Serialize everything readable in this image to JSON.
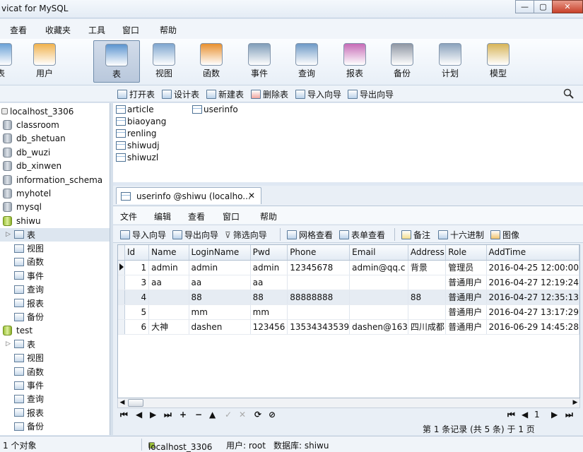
{
  "window": {
    "title": "vicat for MySQL",
    "buttons": [
      "—",
      "▢",
      "✕"
    ]
  },
  "menu": [
    "查看",
    "收藏夹",
    "工具",
    "窗口",
    "帮助"
  ],
  "toolbar": [
    {
      "label": "表",
      "icon": "table-icon",
      "color": "#6aa1d6"
    },
    {
      "label": "用户",
      "icon": "user-icon",
      "color": "#f0b24d"
    },
    {
      "label": "表",
      "icon": "table-icon",
      "color": "#5b94cf",
      "active": true
    },
    {
      "label": "视图",
      "icon": "view-icon",
      "color": "#7ea6cf"
    },
    {
      "label": "函数",
      "icon": "function-icon",
      "color": "#e8902f"
    },
    {
      "label": "事件",
      "icon": "event-icon",
      "color": "#7f9db9"
    },
    {
      "label": "查询",
      "icon": "query-icon",
      "color": "#6d99c6"
    },
    {
      "label": "报表",
      "icon": "report-icon",
      "color": "#c66bb7"
    },
    {
      "label": "备份",
      "icon": "backup-icon",
      "color": "#8e96a3"
    },
    {
      "label": "计划",
      "icon": "schedule-icon",
      "color": "#8aa2bc"
    },
    {
      "label": "模型",
      "icon": "model-icon",
      "color": "#d7b457"
    }
  ],
  "subtoolbar": [
    "打开表",
    "设计表",
    "新建表",
    "删除表",
    "导入向导",
    "导出向导"
  ],
  "tree": [
    {
      "label": "localhost_3306",
      "level": 0,
      "type": "connection"
    },
    {
      "label": "classroom",
      "level": 1,
      "type": "db"
    },
    {
      "label": "db_shetuan",
      "level": 1,
      "type": "db"
    },
    {
      "label": "db_wuzi",
      "level": 1,
      "type": "db"
    },
    {
      "label": "db_xinwen",
      "level": 1,
      "type": "db"
    },
    {
      "label": "information_schema",
      "level": 1,
      "type": "db"
    },
    {
      "label": "myhotel",
      "level": 1,
      "type": "db"
    },
    {
      "label": "mysql",
      "level": 1,
      "type": "db"
    },
    {
      "label": "shiwu",
      "level": 1,
      "type": "db-open"
    },
    {
      "label": "表",
      "level": 2,
      "type": "item",
      "selected": true
    },
    {
      "label": "视图",
      "level": 2,
      "type": "item"
    },
    {
      "label": "函数",
      "level": 2,
      "type": "item"
    },
    {
      "label": "事件",
      "level": 2,
      "type": "item"
    },
    {
      "label": "查询",
      "level": 2,
      "type": "item"
    },
    {
      "label": "报表",
      "level": 2,
      "type": "item"
    },
    {
      "label": "备份",
      "level": 2,
      "type": "item"
    },
    {
      "label": "test",
      "level": 1,
      "type": "db-open"
    },
    {
      "label": "表",
      "level": 2,
      "type": "item"
    },
    {
      "label": "视图",
      "level": 2,
      "type": "item"
    },
    {
      "label": "函数",
      "level": 2,
      "type": "item"
    },
    {
      "label": "事件",
      "level": 2,
      "type": "item"
    },
    {
      "label": "查询",
      "level": 2,
      "type": "item"
    },
    {
      "label": "报表",
      "level": 2,
      "type": "item"
    },
    {
      "label": "备份",
      "level": 2,
      "type": "item"
    }
  ],
  "objects": [
    "article",
    "biaoyang",
    "renling",
    "shiwudj",
    "shiwuzl",
    "userinfo"
  ],
  "doc": {
    "tab_title": "userinfo @shiwu (localho...",
    "menu": [
      "文件",
      "编辑",
      "查看",
      "窗口",
      "帮助"
    ],
    "toolbar": [
      "导入向导",
      "导出向导",
      "筛选向导",
      "网格查看",
      "表单查看",
      "备注",
      "十六进制",
      "图像"
    ],
    "columns": [
      "Id",
      "Name",
      "LoginName",
      "Pwd",
      "Phone",
      "Email",
      "Address",
      "Role",
      "AddTime"
    ],
    "rows": [
      [
        "1",
        "admin",
        "admin",
        "admin",
        "12345678",
        "admin@qq.c",
        "背景",
        "管理员",
        "2016-04-25 12:00:00"
      ],
      [
        "3",
        "aa",
        "aa",
        "aa",
        "",
        "",
        "",
        "普通用户",
        "2016-04-27 12:19:24"
      ],
      [
        "4",
        "",
        "88",
        "88",
        "88888888",
        "",
        "88",
        "普通用户",
        "2016-04-27 12:35:13"
      ],
      [
        "5",
        "",
        "mm",
        "mm",
        "",
        "",
        "",
        "普通用户",
        "2016-04-27 13:17:29"
      ],
      [
        "6",
        "大神",
        "dashen",
        "123456",
        "13534343539",
        "dashen@163",
        "四川成都",
        "普通用户",
        "2016-06-29 14:45:28"
      ]
    ],
    "record_status": "第 1 条记录 (共 5 条) 于 1 页",
    "page_number": "1"
  },
  "status": {
    "objects": "1 个对象",
    "connection": "localhost_3306",
    "user": "用户: root",
    "database": "数据库: shiwu"
  }
}
